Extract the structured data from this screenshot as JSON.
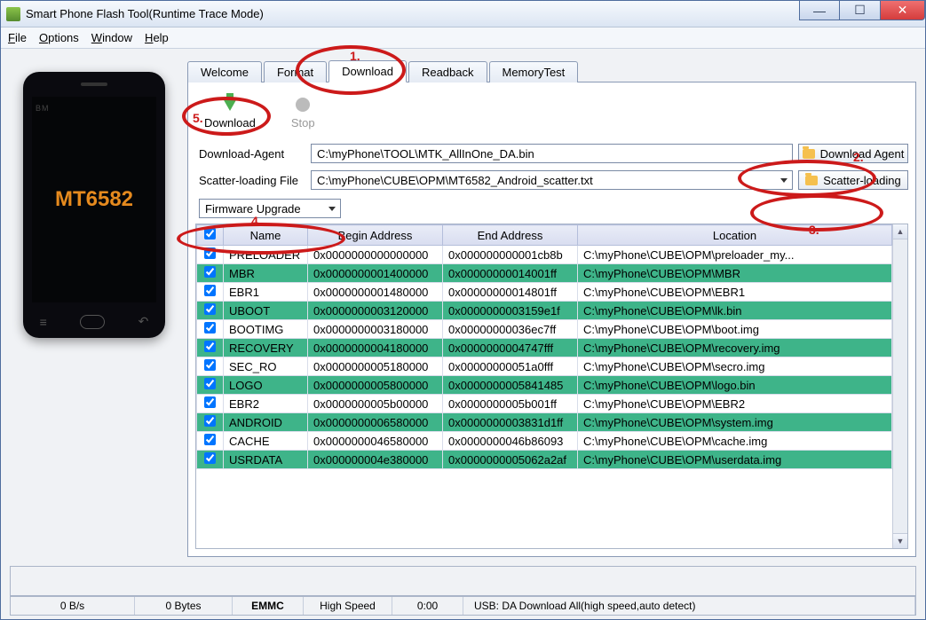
{
  "window": {
    "title": "Smart Phone Flash Tool(Runtime Trace Mode)"
  },
  "menubar": {
    "file": "File",
    "options": "Options",
    "window": "Window",
    "help": "Help"
  },
  "phone": {
    "chip": "MT6582",
    "bm": "BM"
  },
  "tabs": {
    "welcome": "Welcome",
    "format": "Format",
    "download": "Download",
    "readback": "Readback",
    "memorytest": "MemoryTest"
  },
  "actions": {
    "download": "Download",
    "stop": "Stop"
  },
  "form": {
    "da_label": "Download-Agent",
    "da_value": "C:\\myPhone\\TOOL\\MTK_AllInOne_DA.bin",
    "da_button": "Download Agent",
    "scatter_label": "Scatter-loading File",
    "scatter_value": "C:\\myPhone\\CUBE\\OPM\\MT6582_Android_scatter.txt",
    "scatter_button": "Scatter-loading",
    "mode": "Firmware Upgrade"
  },
  "table": {
    "headers": {
      "name": "Name",
      "begin": "Begin Address",
      "end": "End Address",
      "location": "Location"
    },
    "rows": [
      {
        "checked": true,
        "name": "PRELOADER",
        "begin": "0x0000000000000000",
        "end": "0x000000000001cb8b",
        "location": "C:\\myPhone\\CUBE\\OPM\\preloader_my...",
        "green": false
      },
      {
        "checked": true,
        "name": "MBR",
        "begin": "0x0000000001400000",
        "end": "0x00000000014001ff",
        "location": "C:\\myPhone\\CUBE\\OPM\\MBR",
        "green": true
      },
      {
        "checked": true,
        "name": "EBR1",
        "begin": "0x0000000001480000",
        "end": "0x00000000014801ff",
        "location": "C:\\myPhone\\CUBE\\OPM\\EBR1",
        "green": false
      },
      {
        "checked": true,
        "name": "UBOOT",
        "begin": "0x0000000003120000",
        "end": "0x0000000003159e1f",
        "location": "C:\\myPhone\\CUBE\\OPM\\lk.bin",
        "green": true
      },
      {
        "checked": true,
        "name": "BOOTIMG",
        "begin": "0x0000000003180000",
        "end": "0x00000000036ec7ff",
        "location": "C:\\myPhone\\CUBE\\OPM\\boot.img",
        "green": false
      },
      {
        "checked": true,
        "name": "RECOVERY",
        "begin": "0x0000000004180000",
        "end": "0x0000000004747fff",
        "location": "C:\\myPhone\\CUBE\\OPM\\recovery.img",
        "green": true
      },
      {
        "checked": true,
        "name": "SEC_RO",
        "begin": "0x0000000005180000",
        "end": "0x00000000051a0fff",
        "location": "C:\\myPhone\\CUBE\\OPM\\secro.img",
        "green": false
      },
      {
        "checked": true,
        "name": "LOGO",
        "begin": "0x0000000005800000",
        "end": "0x0000000005841485",
        "location": "C:\\myPhone\\CUBE\\OPM\\logo.bin",
        "green": true
      },
      {
        "checked": true,
        "name": "EBR2",
        "begin": "0x0000000005b00000",
        "end": "0x0000000005b001ff",
        "location": "C:\\myPhone\\CUBE\\OPM\\EBR2",
        "green": false
      },
      {
        "checked": true,
        "name": "ANDROID",
        "begin": "0x0000000006580000",
        "end": "0x0000000003831d1ff",
        "location": "C:\\myPhone\\CUBE\\OPM\\system.img",
        "green": true
      },
      {
        "checked": true,
        "name": "CACHE",
        "begin": "0x0000000046580000",
        "end": "0x0000000046b86093",
        "location": "C:\\myPhone\\CUBE\\OPM\\cache.img",
        "green": false
      },
      {
        "checked": true,
        "name": "USRDATA",
        "begin": "0x000000004e380000",
        "end": "0x0000000005062a2af",
        "location": "C:\\myPhone\\CUBE\\OPM\\userdata.img",
        "green": true
      }
    ]
  },
  "status": {
    "speed": "0 B/s",
    "bytes": "0 Bytes",
    "storage": "EMMC",
    "mode": "High Speed",
    "time": "0:00",
    "usb": "USB: DA Download All(high speed,auto detect)"
  },
  "annotations": {
    "a1": "1.",
    "a2": "2.",
    "a3": "3.",
    "a4": "4.",
    "a5": "5."
  }
}
